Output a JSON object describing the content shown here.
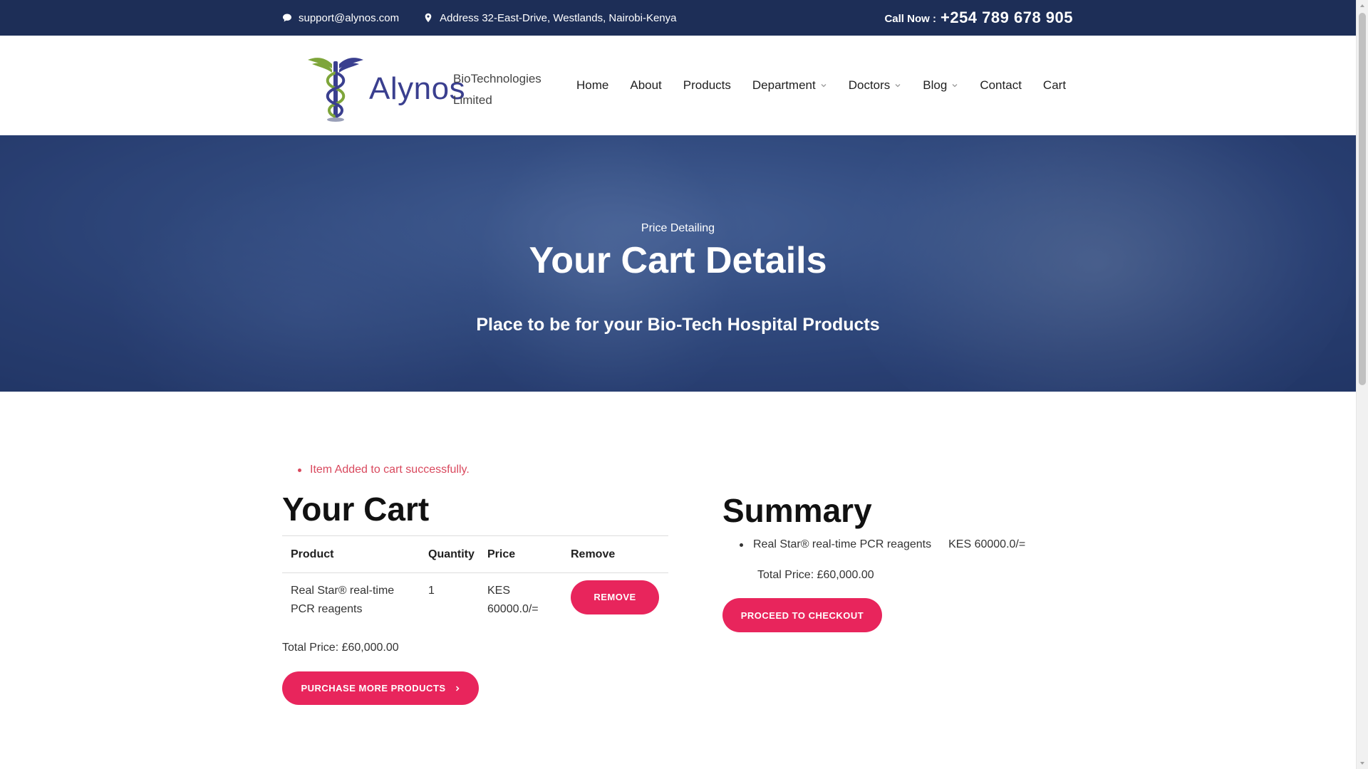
{
  "topbar": {
    "email": "support@alynos.com",
    "address": "Address 32-East-Drive, Westlands, Nairobi-Kenya",
    "call_label": "Call Now :",
    "phone": "+254 789 678 905"
  },
  "brand": {
    "wordmark": "Alynos",
    "tagline": "BioTechnologies Limited"
  },
  "nav": {
    "home": "Home",
    "about": "About",
    "products": "Products",
    "department": "Department",
    "doctors": "Doctors",
    "blog": "Blog",
    "contact": "Contact",
    "cart": "Cart"
  },
  "hero": {
    "eyebrow": "Price Detailing",
    "title": "Your Cart Details",
    "subtitle": "Place to be for your Bio-Tech Hospital Products"
  },
  "flash_message": "Item Added to cart successfully.",
  "cart": {
    "title": "Your Cart",
    "columns": {
      "product": "Product",
      "quantity": "Quantity",
      "price": "Price",
      "remove": "Remove"
    },
    "rows": [
      {
        "product": "Real Star® real-time PCR reagents",
        "quantity": "1",
        "price": "KES 60000.0/=",
        "remove_label": "REMOVE"
      }
    ],
    "total": "Total Price: £60,000.00",
    "purchase_more_label": "PURCHASE MORE PRODUCTS"
  },
  "summary": {
    "title": "Summary",
    "items": [
      {
        "name": "Real Star® real-time PCR reagents",
        "amount": "KES 60000.0/="
      }
    ],
    "total": "Total Price: £60,000.00",
    "checkout_label": "PROCEED TO CHECKOUT"
  },
  "colors": {
    "topbar_bg": "#1d2e57",
    "accent": "#e8255c",
    "flash_text": "#d9495e",
    "logo_text": "#3a3f8f"
  }
}
